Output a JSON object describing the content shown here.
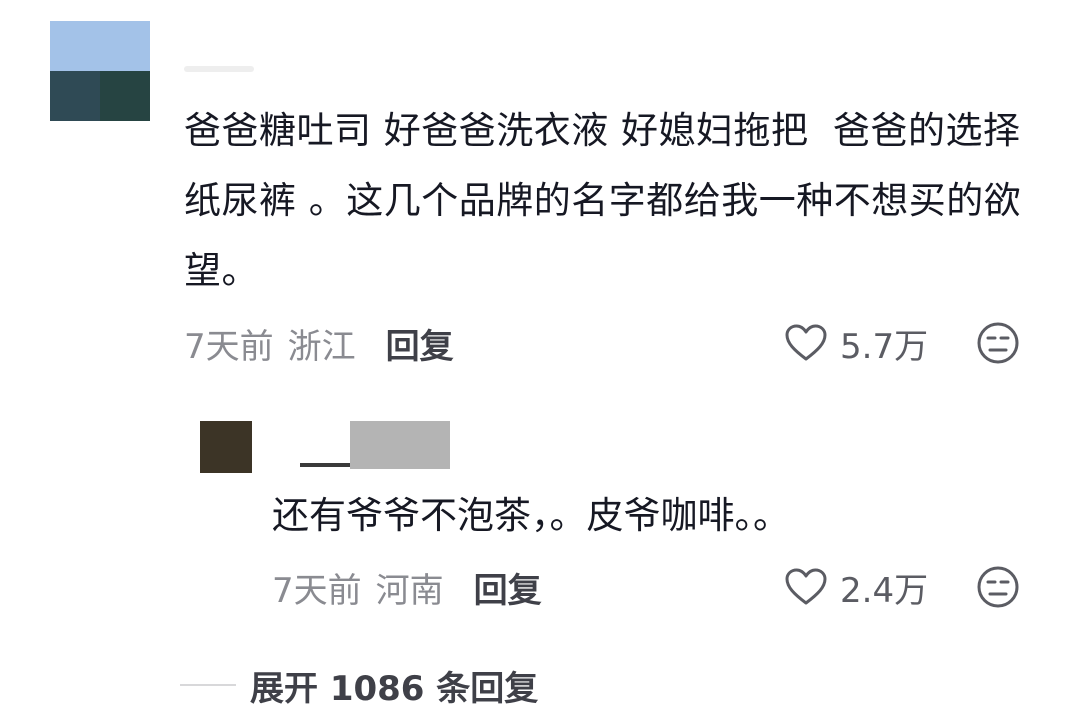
{
  "comment": {
    "text": "爸爸糖吐司 好爸爸洗衣液 好媳妇拖把  爸爸的选择纸尿裤 。这几个品牌的名字都给我一种不想买的欲望。",
    "time": "7天前",
    "location": "浙江",
    "reply_label": "回复",
    "likes": "5.7万",
    "icons": {
      "like": "heart-icon",
      "dislike": "meh-face-icon"
    }
  },
  "reply": {
    "text": "还有爷爷不泡茶，。皮爷咖啡。。",
    "time": "7天前",
    "location": "河南",
    "reply_label": "回复",
    "likes": "2.4万",
    "icons": {
      "like": "heart-icon",
      "dislike": "meh-face-icon"
    }
  },
  "expand": {
    "label": "展开 1086 条回复"
  },
  "colors": {
    "text_primary": "#161823",
    "text_secondary": "#8a8b91",
    "text_action": "#3f4048"
  }
}
